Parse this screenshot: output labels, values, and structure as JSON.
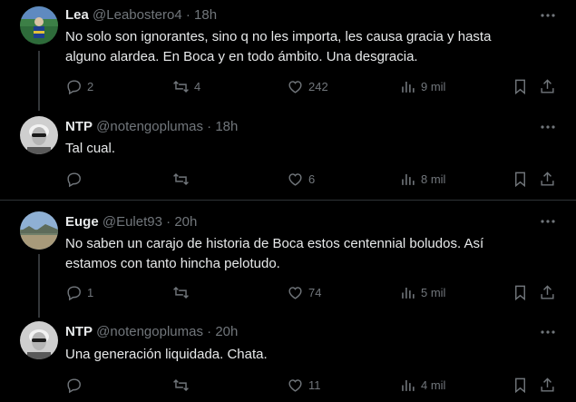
{
  "tweets": [
    {
      "name": "Lea",
      "handle": "@Leabostero4",
      "dot": "·",
      "time": "18h",
      "text_lines": [
        "No solo son ignorantes, sino q no les importa, les causa gracia y hasta",
        "alguno alardea. En Boca y en todo ámbito. Una desgracia."
      ],
      "replies": "2",
      "retweets": "4",
      "likes": "242",
      "views": "9 mil"
    },
    {
      "name": "NTP",
      "handle": "@notengoplumas",
      "dot": "·",
      "time": "18h",
      "text_lines": [
        "Tal cual."
      ],
      "replies": "",
      "retweets": "",
      "likes": "6",
      "views": "8 mil"
    },
    {
      "name": "Euge",
      "handle": "@Eulet93",
      "dot": "·",
      "time": "20h",
      "text_lines": [
        "No saben un carajo de historia de Boca estos centennial boludos. Así",
        "estamos con tanto hincha pelotudo."
      ],
      "replies": "1",
      "retweets": "",
      "likes": "74",
      "views": "5 mil"
    },
    {
      "name": "NTP",
      "handle": "@notengoplumas",
      "dot": "·",
      "time": "20h",
      "text_lines": [
        "Una generación liquidada. Chata."
      ],
      "replies": "",
      "retweets": "",
      "likes": "11",
      "views": "4 mil"
    }
  ],
  "icons": [
    "reply-icon",
    "retweet-icon",
    "like-icon",
    "views-icon",
    "bookmark-icon",
    "share-icon",
    "more-icon"
  ]
}
